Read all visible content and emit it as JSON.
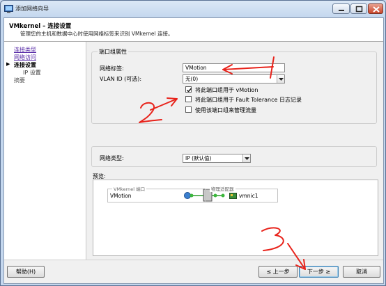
{
  "window": {
    "title": "添加网络向导",
    "accent": "#2f5fa8",
    "controls": [
      "minimize-icon",
      "maximize-icon",
      "close-icon"
    ]
  },
  "header": {
    "title": "VMkernel – 连接设置",
    "subtitle": "管理您的主机和数据中心时使用网络标签来识别 VMkernel 连接。"
  },
  "nav": {
    "items": [
      {
        "label": "连接类型",
        "state": "link"
      },
      {
        "label": "网络访问",
        "state": "link"
      },
      {
        "label": "连接设置",
        "state": "active"
      },
      {
        "label": "IP 设置",
        "state": "sub"
      },
      {
        "label": "摘要",
        "state": "pending"
      }
    ]
  },
  "port_group": {
    "legend": "端口组属性",
    "network_label": {
      "label": "网络标签:",
      "value": "VMotion"
    },
    "vlan": {
      "label": "VLAN ID (可选):",
      "value": "无(0)"
    },
    "checkboxes": [
      {
        "label": "将此端口组用于 vMotion",
        "checked": true
      },
      {
        "label": "将此端口组用于 Fault Tolerance 日志记录",
        "checked": false
      },
      {
        "label": "使用该端口组来管理流量",
        "checked": false
      }
    ]
  },
  "network_type": {
    "label": "网络类型:",
    "value": "IP (默认值)"
  },
  "preview": {
    "label": "预览:",
    "vmkernel_legend": "VMkernel 端口",
    "vmkernel_name": "VMotion",
    "adapter_legend": "物理适配器",
    "adapter_name": "vmnic1"
  },
  "annotations": [
    "1",
    "2",
    "3"
  ],
  "footer": {
    "help": "帮助(H)",
    "back": "≤ 上一步",
    "next": "下一步 ≥",
    "cancel": "取消"
  },
  "colors": {
    "annotation_red": "#e8231b",
    "link_purple": "#5a2ea8",
    "background": "#f0f0f0"
  }
}
